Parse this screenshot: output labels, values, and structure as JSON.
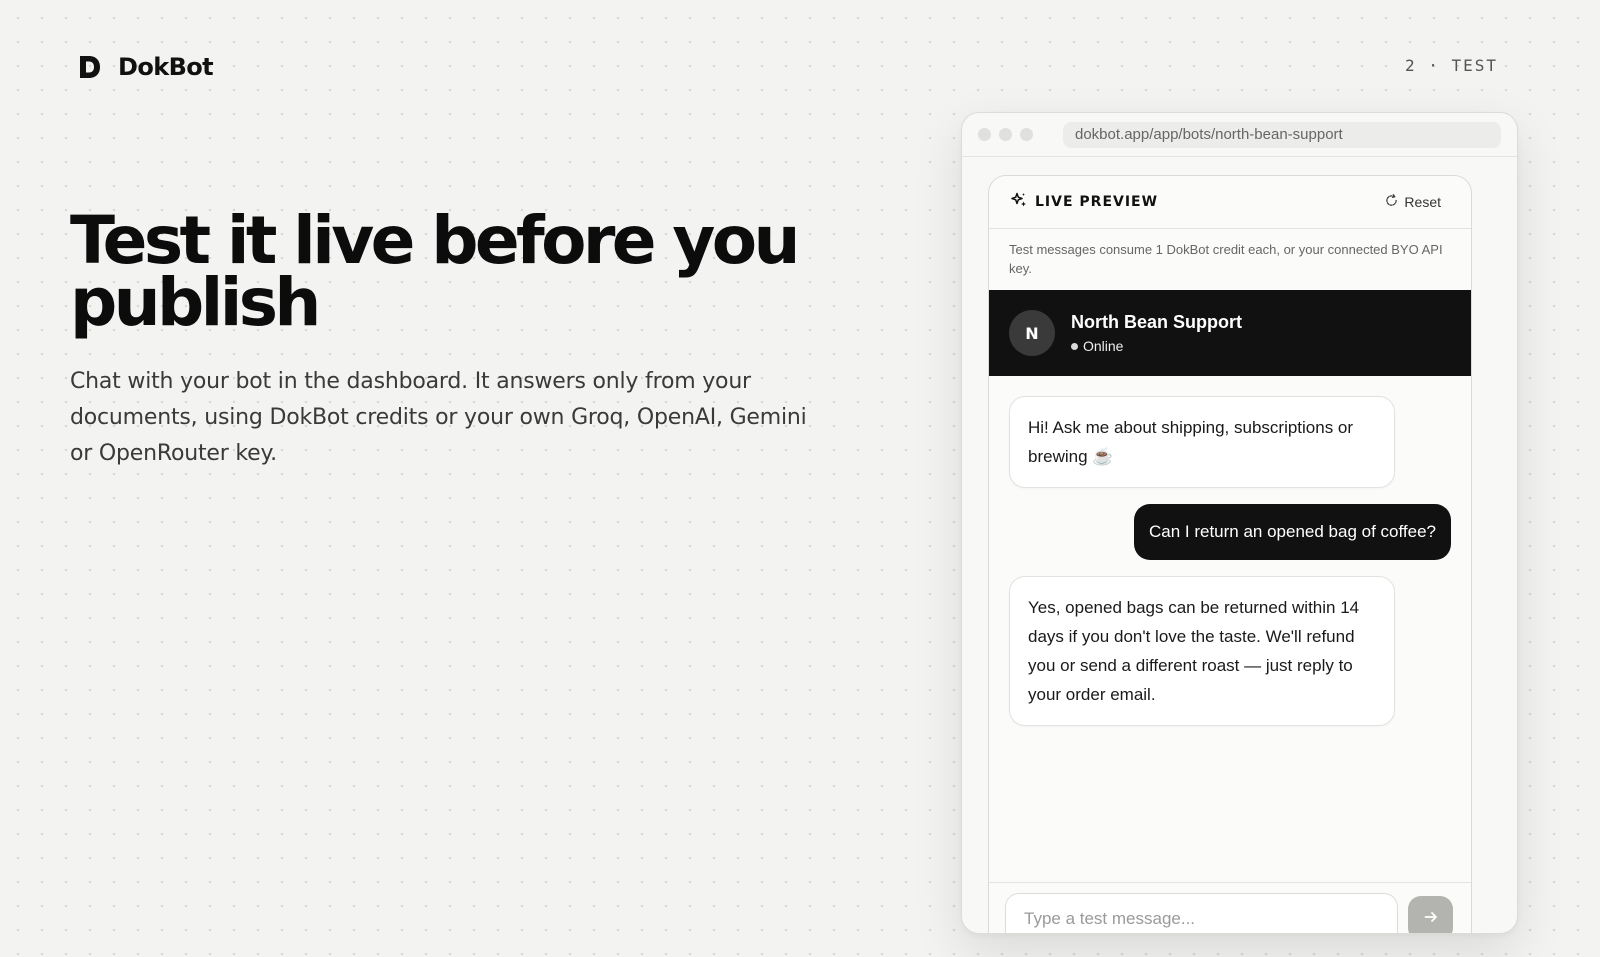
{
  "brand": {
    "name": "DokBot",
    "logo_icon": "dokbot-logo-icon"
  },
  "slide_label": "2 · TEST",
  "hero": {
    "title": "Test it live before you publish",
    "subtitle": "Chat with your bot in the dashboard. It answers only from your documents, using DokBot credits or your own Groq, OpenAI, Gemini or OpenRouter key."
  },
  "browser": {
    "url": "dokbot.app/app/bots/north-bean-support"
  },
  "preview": {
    "title": "LIVE PREVIEW",
    "title_icon": "sparkles-icon",
    "reset_label": "Reset",
    "reset_icon": "refresh-icon",
    "notice": "Test messages consume 1 DokBot credit each, or your connected BYO API key."
  },
  "chat": {
    "avatar_initial": "N",
    "bot_name": "North Bean Support",
    "status": "Online",
    "messages": [
      {
        "role": "bot",
        "text": "Hi! Ask me about shipping, subscriptions or brewing ☕"
      },
      {
        "role": "user",
        "text": "Can I return an opened bag of coffee?"
      },
      {
        "role": "bot",
        "text": "Yes, opened bags can be returned within 14 days if you don't love the taste. We'll refund you or send a different roast — just reply to your order email."
      }
    ],
    "input_placeholder": "Type a test message...",
    "send_icon": "arrow-right-icon"
  },
  "colors": {
    "background": "#f3f3f1",
    "ink": "#111111",
    "send_disabled": "#b3b3b0"
  }
}
